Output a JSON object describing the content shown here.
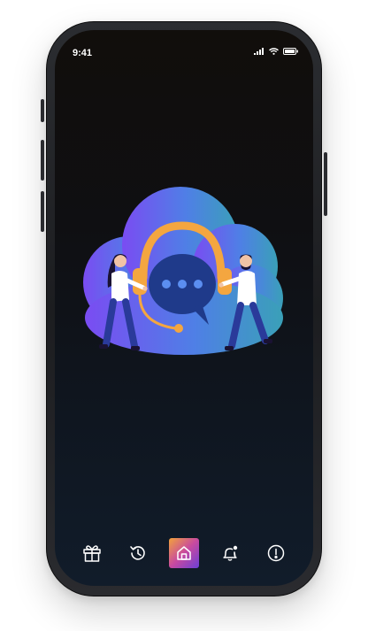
{
  "status_bar": {
    "time": "9:41",
    "icons": [
      "signal-icon",
      "wifi-icon",
      "battery-icon"
    ]
  },
  "hero": {
    "illustration": "customer-support-illustration",
    "icons": [
      "headset-icon",
      "chat-bubble-icon"
    ]
  },
  "tab_bar": {
    "active_index": 2,
    "tabs": [
      {
        "icon": "gift-icon"
      },
      {
        "icon": "history-icon"
      },
      {
        "icon": "home-icon"
      },
      {
        "icon": "notification-bell-icon"
      },
      {
        "icon": "info-icon"
      }
    ]
  },
  "colors": {
    "accent_gradient": [
      "#f2a23a",
      "#c84aa0",
      "#6b3fd6"
    ],
    "cloud_gradient": [
      "#7a4cf2",
      "#3aa0b8"
    ],
    "headset": "#f4a640",
    "bubble": "#1f3a8a",
    "screen_bg": "#0f0f12"
  }
}
